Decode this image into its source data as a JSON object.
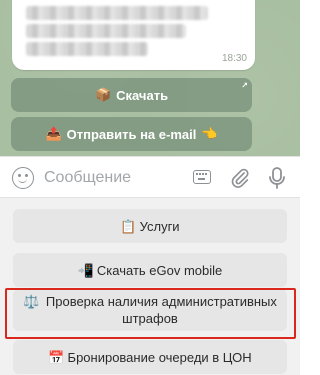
{
  "chat": {
    "message_time": "18:30",
    "buttons": {
      "download": {
        "emoji": "📦",
        "label": "Скачать"
      },
      "email": {
        "emoji": "📤",
        "label": "Отправить на e-mail",
        "emoji_after": "👈"
      }
    }
  },
  "input_bar": {
    "placeholder": "Сообщение"
  },
  "keyboard": {
    "services": {
      "emoji": "📋",
      "label": "Услуги"
    },
    "egov": {
      "emoji": "📲",
      "label": "Скачать eGov mobile"
    },
    "fines": {
      "emoji": "⚖️",
      "label": "Проверка наличия административных штрафов"
    },
    "queue": {
      "emoji": "📅",
      "label": "Бронирование очереди в ЦОН"
    }
  },
  "colors": {
    "chat_background": "#a9bfa1",
    "inline_button": "#768d78",
    "highlight": "#d9291c",
    "keyboard_background": "#f1f1f2",
    "keyboard_button": "#e6e6e7"
  }
}
